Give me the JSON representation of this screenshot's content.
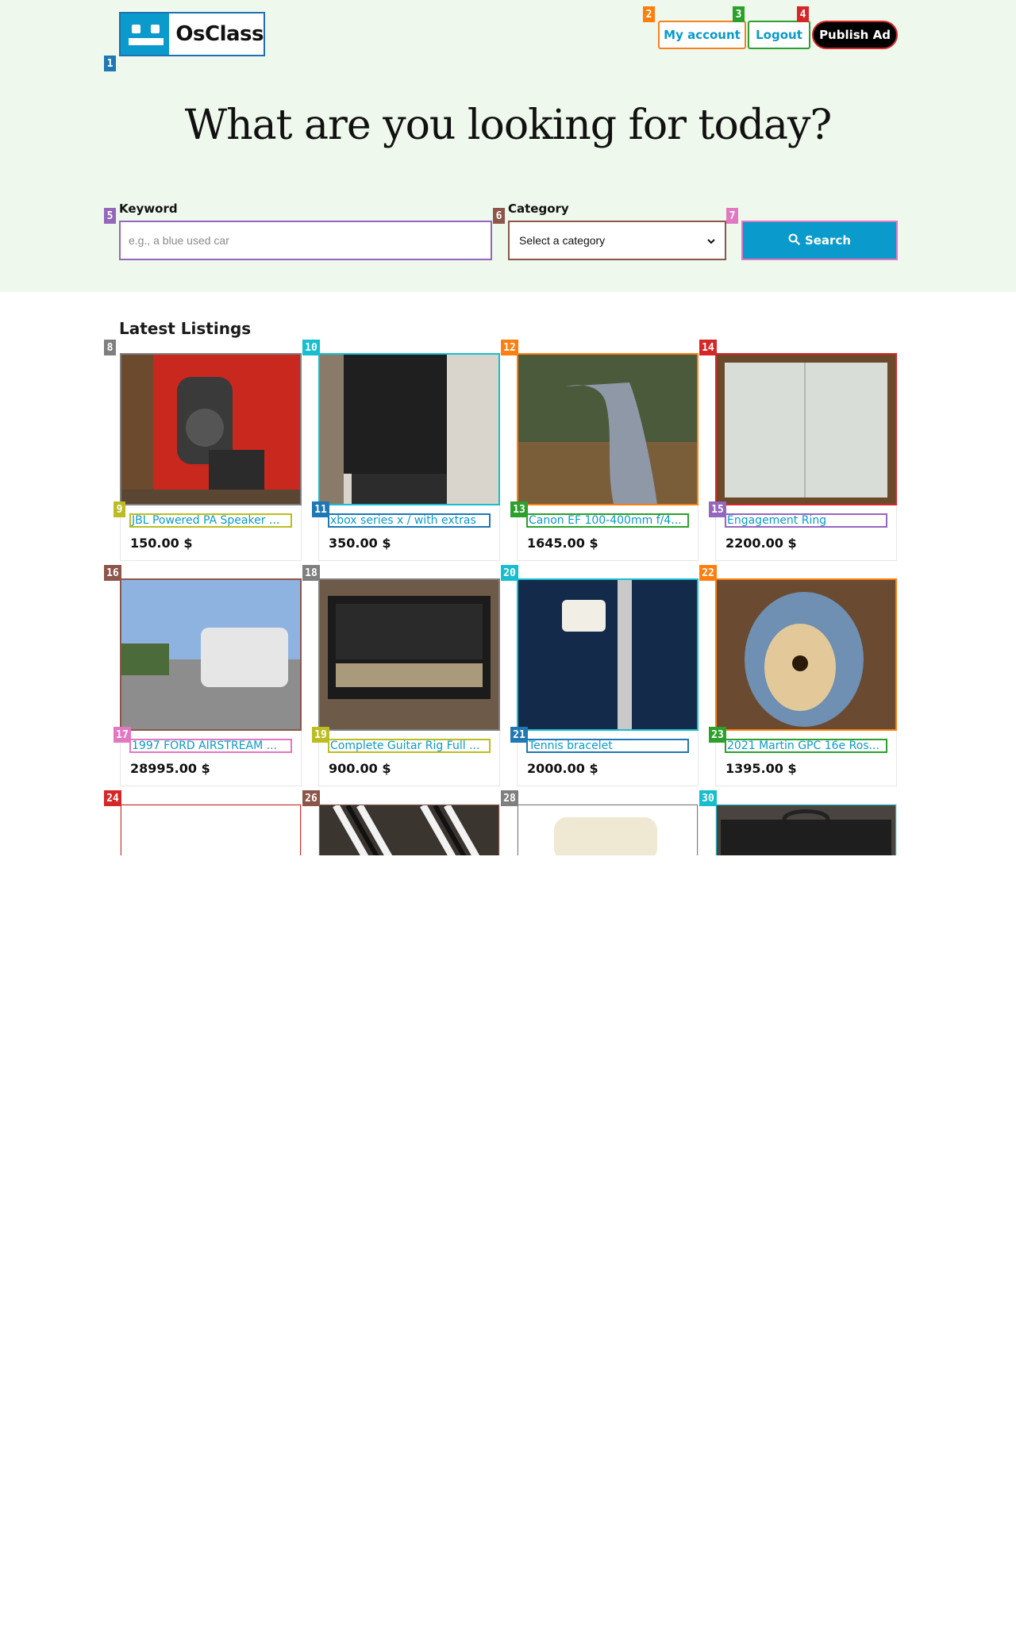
{
  "brand": {
    "logo_text": "OsClass",
    "accent": "#0a9acb"
  },
  "header": {
    "my_account_label": "My account",
    "logout_label": "Logout",
    "publish_label": "Publish Ad"
  },
  "hero": {
    "headline": "What are you looking for today?"
  },
  "search": {
    "keyword_label": "Keyword",
    "keyword_placeholder": "e.g., a blue used car",
    "category_label": "Category",
    "category_selected": "Select a category",
    "button_label": "Search",
    "button_icon": "search-icon"
  },
  "latest": {
    "title": "Latest Listings",
    "listings": [
      {
        "title": "JBL Powered PA Speaker ...",
        "price": "150.00 $"
      },
      {
        "title": "xbox series x / with extras",
        "price": "350.00 $"
      },
      {
        "title": "Canon EF 100-400mm f/4...",
        "price": "1645.00 $"
      },
      {
        "title": "Engagement Ring",
        "price": "2200.00 $"
      },
      {
        "title": "1997 FORD AIRSTREAM ...",
        "price": "28995.00 $"
      },
      {
        "title": "Complete Guitar Rig Full ...",
        "price": "900.00 $"
      },
      {
        "title": "Tennis bracelet",
        "price": "2000.00 $"
      },
      {
        "title": "2021 Martin GPC 16e Ros...",
        "price": "1395.00 $"
      }
    ],
    "partial_listings_count": 4
  },
  "overlay_tags": [
    "1",
    "2",
    "3",
    "4",
    "5",
    "6",
    "7",
    "8",
    "9",
    "10",
    "11",
    "12",
    "13",
    "14",
    "15",
    "16",
    "17",
    "18",
    "19",
    "20",
    "21",
    "22",
    "23",
    "24",
    "26",
    "28",
    "30"
  ],
  "overlay_colors": {
    "blue": "#1f77b4",
    "orange": "#ff7f0e",
    "green": "#2ca02c",
    "red": "#d62728",
    "purple": "#9467bd",
    "brown": "#8c564b",
    "pink": "#e377c2",
    "gray": "#7f7f7f",
    "olive": "#bcbd22",
    "cyan": "#17becf"
  }
}
